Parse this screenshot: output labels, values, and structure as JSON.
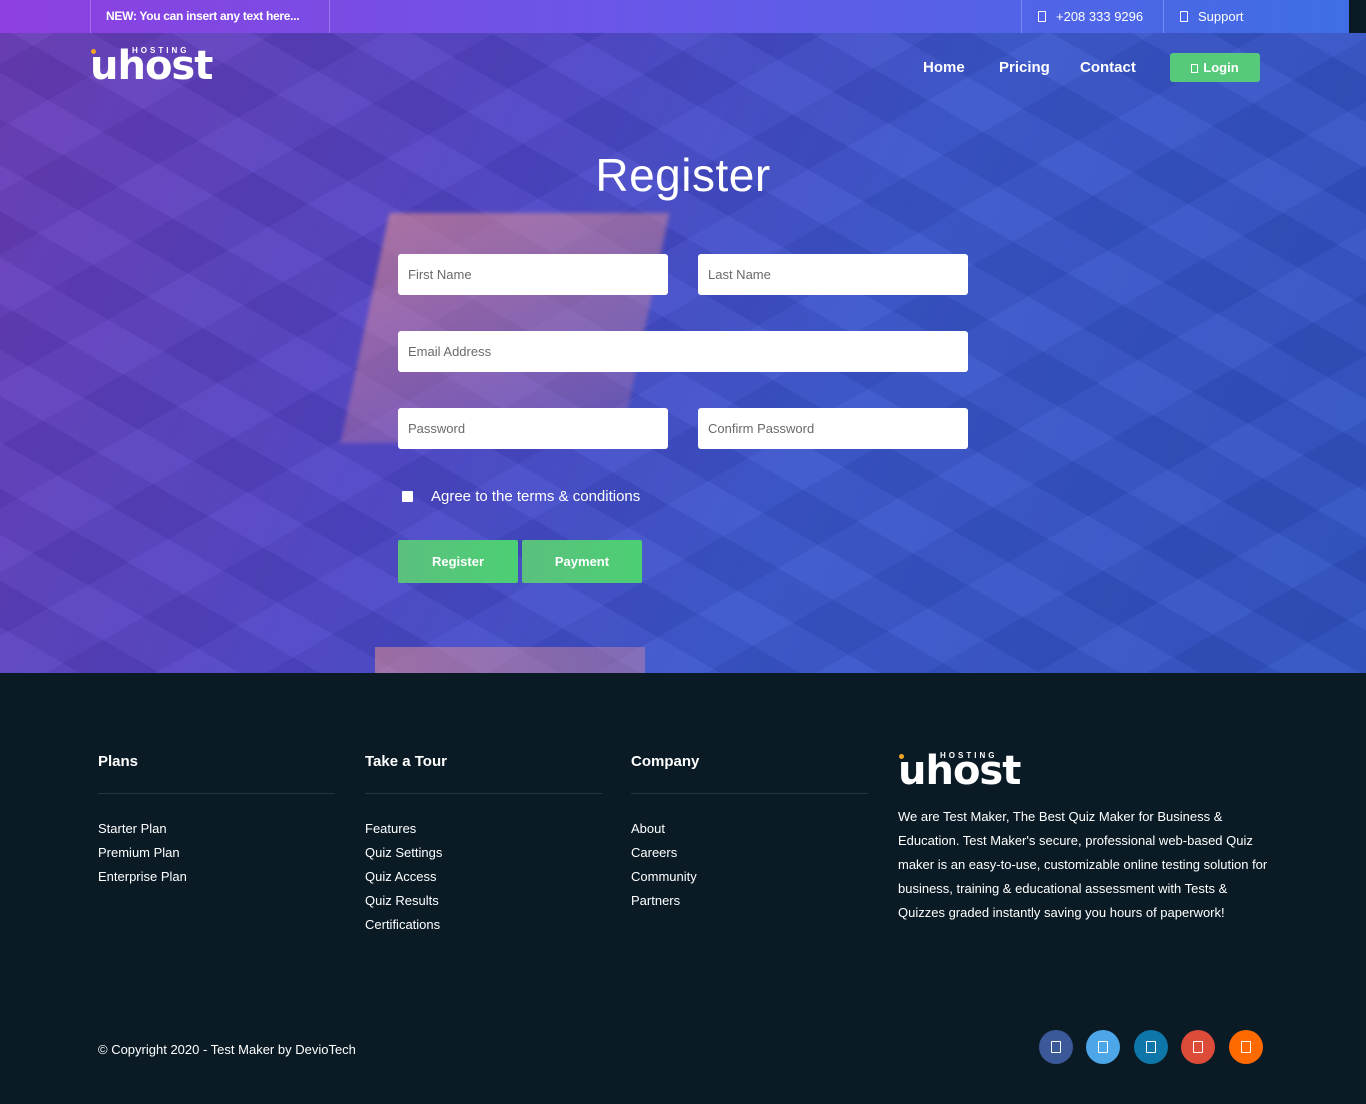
{
  "topbar": {
    "news": "NEW: You can insert any text here...",
    "phone": "+208 333 9296",
    "support": "Support",
    "phone_icon": "phone-icon",
    "support_icon": "support-icon"
  },
  "brand": {
    "name": "uhost",
    "tagline": "HOSTING"
  },
  "nav": {
    "home": "Home",
    "pricing": "Pricing",
    "contact": "Contact",
    "login": "Login"
  },
  "register": {
    "title": "Register",
    "first_name_placeholder": "First Name",
    "last_name_placeholder": "Last Name",
    "email_placeholder": "Email Address",
    "password_placeholder": "Password",
    "confirm_placeholder": "Confirm Password",
    "agree_label": "Agree to the terms & conditions",
    "agree_checked": false,
    "register_button": "Register",
    "payment_button": "Payment"
  },
  "footer": {
    "plans": {
      "title": "Plans",
      "items": [
        "Starter Plan",
        "Premium Plan",
        "Enterprise Plan"
      ]
    },
    "tour": {
      "title": "Take a Tour",
      "items": [
        "Features",
        "Quiz Settings",
        "Quiz Access",
        "Quiz Results",
        "Certifications"
      ]
    },
    "company": {
      "title": "Company",
      "items": [
        "About",
        "Careers",
        "Community",
        "Partners"
      ]
    },
    "about_text": "We are Test Maker, The Best Quiz Maker for Business & Education. Test Maker's secure, professional web-based Quiz maker is an easy-to-use, customizable online testing solution for business, training & educational assessment with Tests & Quizzes graded instantly saving you hours of paperwork!",
    "copyright": "© Copyright 2020 - Test Maker by DevioTech",
    "social": [
      {
        "icon": "facebook-icon",
        "color": "#3b5998"
      },
      {
        "icon": "twitter-icon",
        "color": "#4ca6e8"
      },
      {
        "icon": "linkedin-icon",
        "color": "#0e76a8"
      },
      {
        "icon": "google-plus-icon",
        "color": "#dd4b39"
      },
      {
        "icon": "rss-icon",
        "color": "#ff6a00"
      }
    ]
  },
  "colors": {
    "accent_green": "#56c97a",
    "footer_bg": "#0a1b25"
  }
}
